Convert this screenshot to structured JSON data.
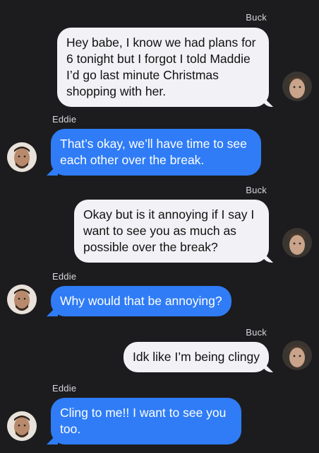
{
  "messages": [
    {
      "sender": "Buck",
      "text": "Hey babe, I know we had plans for 6 tonight but I forgot I told Maddie I’d go last minute Christmas shopping with her."
    },
    {
      "sender": "Eddie",
      "text": "That’s okay, we’ll have time to see each other over the break."
    },
    {
      "sender": "Buck",
      "text": "Okay but is it annoying if I say I want to see you as much as possible over the break?"
    },
    {
      "sender": "Eddie",
      "text": "Why would that be annoying?"
    },
    {
      "sender": "Buck",
      "text": "Idk like I’m being clingy"
    },
    {
      "sender": "Eddie",
      "text": "Cling to me!! I want to see you too."
    }
  ],
  "colors": {
    "background": "#1c1c1e",
    "incoming_bubble": "#f2f2f6",
    "outgoing_bubble": "#2f7cf6"
  }
}
